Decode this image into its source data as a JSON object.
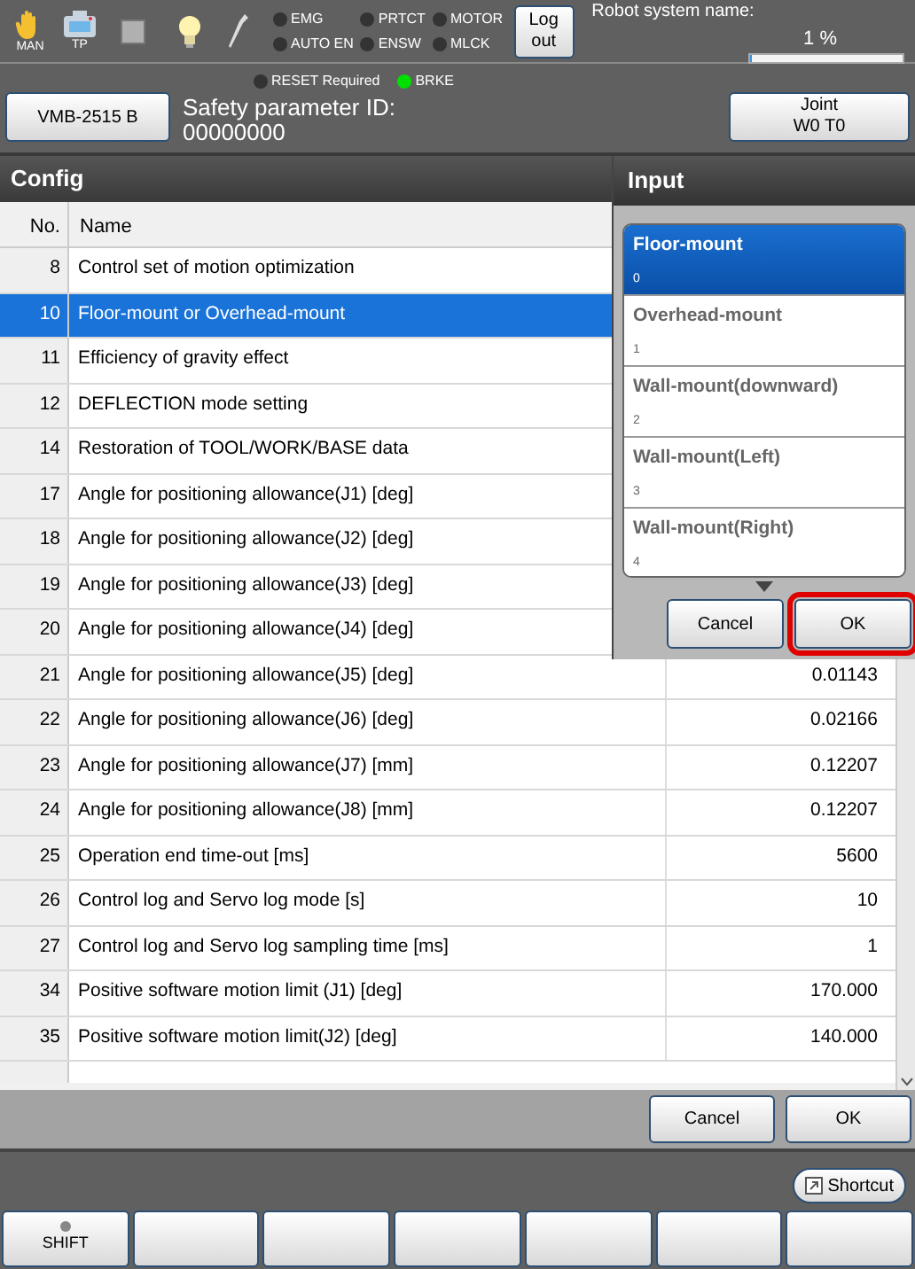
{
  "header": {
    "mode_icons": [
      {
        "label": "MAN"
      },
      {
        "label": "TP"
      }
    ],
    "indicators": [
      {
        "label": "EMG",
        "on": false
      },
      {
        "label": "AUTO EN",
        "on": false
      },
      {
        "label": "PRTCT",
        "on": false
      },
      {
        "label": "ENSW",
        "on": false
      },
      {
        "label": "MOTOR",
        "on": false
      },
      {
        "label": "MLCK",
        "on": false
      }
    ],
    "logout_button": "Log out",
    "robot_system_label": "Robot system name:",
    "progress_reading": "1 %",
    "progress": {
      "level": 0.01
    }
  },
  "status_bar": {
    "indicators": [
      {
        "label": "RESET Required",
        "on": false
      },
      {
        "label": "BRKE",
        "on": true
      }
    ],
    "model_button": "VMB-2515 B",
    "safety_label": "Safety parameter ID:",
    "safety_id": "00000000",
    "joint_button": [
      "Joint",
      "W0 T0"
    ]
  },
  "config": {
    "title": "Config",
    "columns": [
      "No.",
      "Name"
    ],
    "rows": [
      {
        "no": "8",
        "name": "Control set of motion optimization",
        "value": "",
        "selected": false
      },
      {
        "no": "10",
        "name": "Floor-mount or Overhead-mount",
        "value": "",
        "selected": true
      },
      {
        "no": "11",
        "name": "Efficiency of gravity effect",
        "value": "",
        "selected": false
      },
      {
        "no": "12",
        "name": "DEFLECTION mode setting",
        "value": "",
        "selected": false
      },
      {
        "no": "14",
        "name": "Restoration of TOOL/WORK/BASE data",
        "value": "",
        "selected": false
      },
      {
        "no": "17",
        "name": "Angle for positioning allowance(J1) [deg]",
        "value": "",
        "selected": false
      },
      {
        "no": "18",
        "name": "Angle for positioning allowance(J2) [deg]",
        "value": "",
        "selected": false
      },
      {
        "no": "19",
        "name": "Angle for positioning allowance(J3) [deg]",
        "value": "",
        "selected": false
      },
      {
        "no": "20",
        "name": "Angle for positioning allowance(J4) [deg]",
        "value": "",
        "selected": false
      },
      {
        "no": "21",
        "name": "Angle for positioning allowance(J5) [deg]",
        "value": "0.01143",
        "selected": false
      },
      {
        "no": "22",
        "name": "Angle for positioning allowance(J6) [deg]",
        "value": "0.02166",
        "selected": false
      },
      {
        "no": "23",
        "name": "Angle for positioning allowance(J7) [mm]",
        "value": "0.12207",
        "selected": false
      },
      {
        "no": "24",
        "name": "Angle for positioning allowance(J8) [mm]",
        "value": "0.12207",
        "selected": false
      },
      {
        "no": "25",
        "name": "Operation end time-out  [ms]",
        "value": "5600",
        "selected": false
      },
      {
        "no": "26",
        "name": "Control log and Servo log mode [s]",
        "value": "10",
        "selected": false
      },
      {
        "no": "27",
        "name": "Control log and Servo log sampling time [ms]",
        "value": "1",
        "selected": false
      },
      {
        "no": "34",
        "name": "Positive software motion limit (J1) [deg]",
        "value": "170.000",
        "selected": false
      },
      {
        "no": "35",
        "name": "Positive software motion limit(J2) [deg]",
        "value": "140.000",
        "selected": false
      }
    ],
    "buttons": [
      {
        "label": "Cancel"
      },
      {
        "label": "OK"
      }
    ]
  },
  "input_dialog": {
    "title": "Input",
    "options": [
      {
        "label": "Floor-mount",
        "value": "0",
        "selected": true
      },
      {
        "label": "Overhead-mount",
        "value": "1",
        "selected": false
      },
      {
        "label": "Wall-mount(downward)",
        "value": "2",
        "selected": false
      },
      {
        "label": "Wall-mount(Left)",
        "value": "3",
        "selected": false
      },
      {
        "label": "Wall-mount(Right)",
        "value": "4",
        "selected": false
      }
    ],
    "buttons": [
      {
        "label": "Cancel",
        "highlighted": false
      },
      {
        "label": "OK",
        "highlighted": true
      }
    ]
  },
  "footer": {
    "shortcut_button": "Shortcut",
    "function_keys": [
      {
        "kind": "shift",
        "label": "SHIFT"
      },
      {
        "kind": "blank"
      },
      {
        "kind": "blank"
      },
      {
        "kind": "blank"
      },
      {
        "kind": "blank"
      },
      {
        "kind": "blank"
      },
      {
        "kind": "blank"
      }
    ]
  }
}
